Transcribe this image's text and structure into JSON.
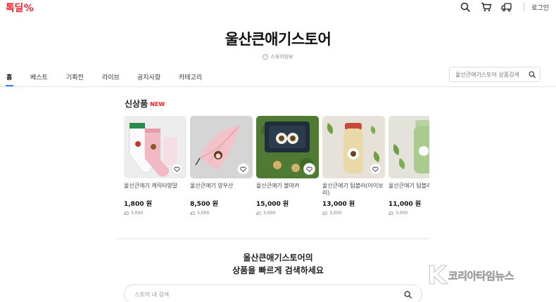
{
  "header": {
    "logo_text": "톡딜",
    "logo_symbol": "%",
    "brand_color": "#e8262c",
    "icons": [
      "search-icon",
      "cart-icon",
      "delivery-truck-icon"
    ],
    "login_label": "로그인"
  },
  "store": {
    "title": "울산큰애기스토어",
    "info_label": "스토어정보"
  },
  "nav": {
    "tabs": [
      {
        "label": "홈",
        "active": true
      },
      {
        "label": "베스트",
        "active": false
      },
      {
        "label": "기획전",
        "active": false
      },
      {
        "label": "라이브",
        "active": false
      },
      {
        "label": "공지사항",
        "active": false
      },
      {
        "label": "카테고리",
        "active": false
      }
    ],
    "search_placeholder": "울산큰애기스토어 상품검색",
    "accent_color": "#2d7ff9"
  },
  "new_products": {
    "title": "신상품",
    "badge": "NEW",
    "items": [
      {
        "name": "울산큰애기 캐릭터양말",
        "price": "1,800 원",
        "shipping": "3,000"
      },
      {
        "name": "울산큰애기 양우산",
        "price": "8,500 원",
        "shipping": "3,000"
      },
      {
        "name": "울산큰애기 볼마커",
        "price": "15,000 원",
        "shipping": "3,000"
      },
      {
        "name": "울산큰애기 텀블러(아이보리)",
        "price": "13,000 원",
        "shipping": "3,000"
      },
      {
        "name": "울산큰애기 텀블러(그린)",
        "price": "11,000 원",
        "shipping": "3,000"
      }
    ]
  },
  "store_search": {
    "headline_line1": "울산큰애기스토어의",
    "headline_line2": "상품을 빠르게 검색하세요",
    "placeholder": "스토어 내 검색"
  },
  "watermark": {
    "letter": "K",
    "text": "코리아타임뉴스"
  }
}
